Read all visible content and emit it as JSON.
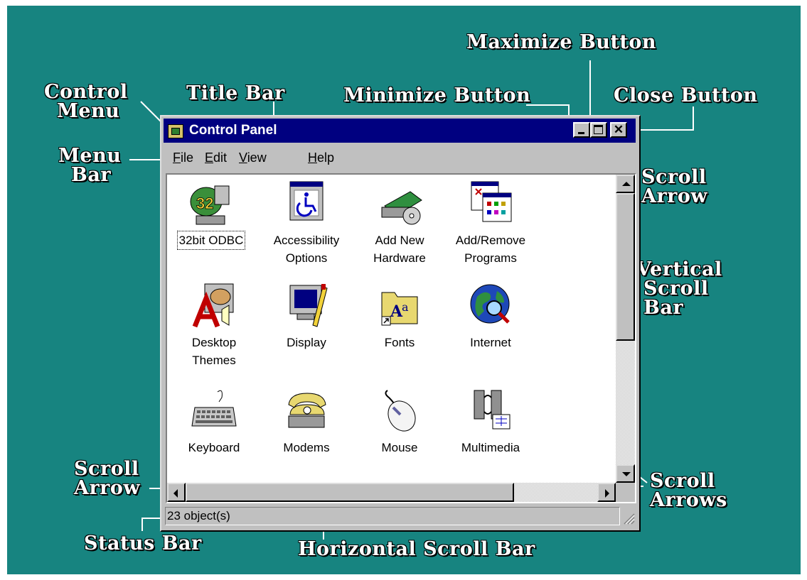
{
  "window": {
    "title": "Control Panel",
    "menu": [
      {
        "label": "File",
        "mnemonic": "F",
        "rest": "ile"
      },
      {
        "label": "Edit",
        "mnemonic": "E",
        "rest": "dit"
      },
      {
        "label": "View",
        "mnemonic": "V",
        "rest": "iew"
      },
      {
        "label": "Help",
        "mnemonic": "H",
        "rest": "elp"
      }
    ],
    "close_glyph": "✕",
    "items": [
      {
        "label": "32bit ODBC",
        "icon": "odbc-icon",
        "selected": true
      },
      {
        "label": "Accessibility Options",
        "icon": "accessibility-icon"
      },
      {
        "label": "Add New Hardware",
        "icon": "hardware-icon"
      },
      {
        "label": "Add/Remove Programs",
        "icon": "add-remove-programs-icon"
      },
      {
        "label": "Desktop Themes",
        "icon": "desktop-themes-icon"
      },
      {
        "label": "Display",
        "icon": "display-icon"
      },
      {
        "label": "Fonts",
        "icon": "fonts-folder-icon"
      },
      {
        "label": "Internet",
        "icon": "internet-globe-icon"
      },
      {
        "label": "Keyboard",
        "icon": "keyboard-icon"
      },
      {
        "label": "Modems",
        "icon": "modem-phone-icon"
      },
      {
        "label": "Mouse",
        "icon": "mouse-icon"
      },
      {
        "label": "Multimedia",
        "icon": "multimedia-icon"
      }
    ],
    "status": "23 object(s)"
  },
  "labels": {
    "control_menu": [
      "Control",
      "Menu"
    ],
    "title_bar": "Title Bar",
    "minimize_button": "Minimize Button",
    "maximize_button": "Maximize Button",
    "close_button": "Close Button",
    "menu_bar": [
      "Menu",
      "Bar"
    ],
    "scroll_arrow_top": [
      "Scroll",
      "Arrow"
    ],
    "vertical_scroll_bar": [
      "Vertical",
      "Scroll",
      "Bar"
    ],
    "scroll_arrow_left": [
      "Scroll",
      "Arrow"
    ],
    "scroll_arrows": [
      "Scroll",
      "Arrows"
    ],
    "status_bar": "Status Bar",
    "horizontal_scroll_bar": "Horizontal Scroll Bar"
  },
  "colors": {
    "background": "#178480",
    "title_bar": "#000080",
    "window_face": "#c0c0c0",
    "label_text": "#ffffff"
  }
}
